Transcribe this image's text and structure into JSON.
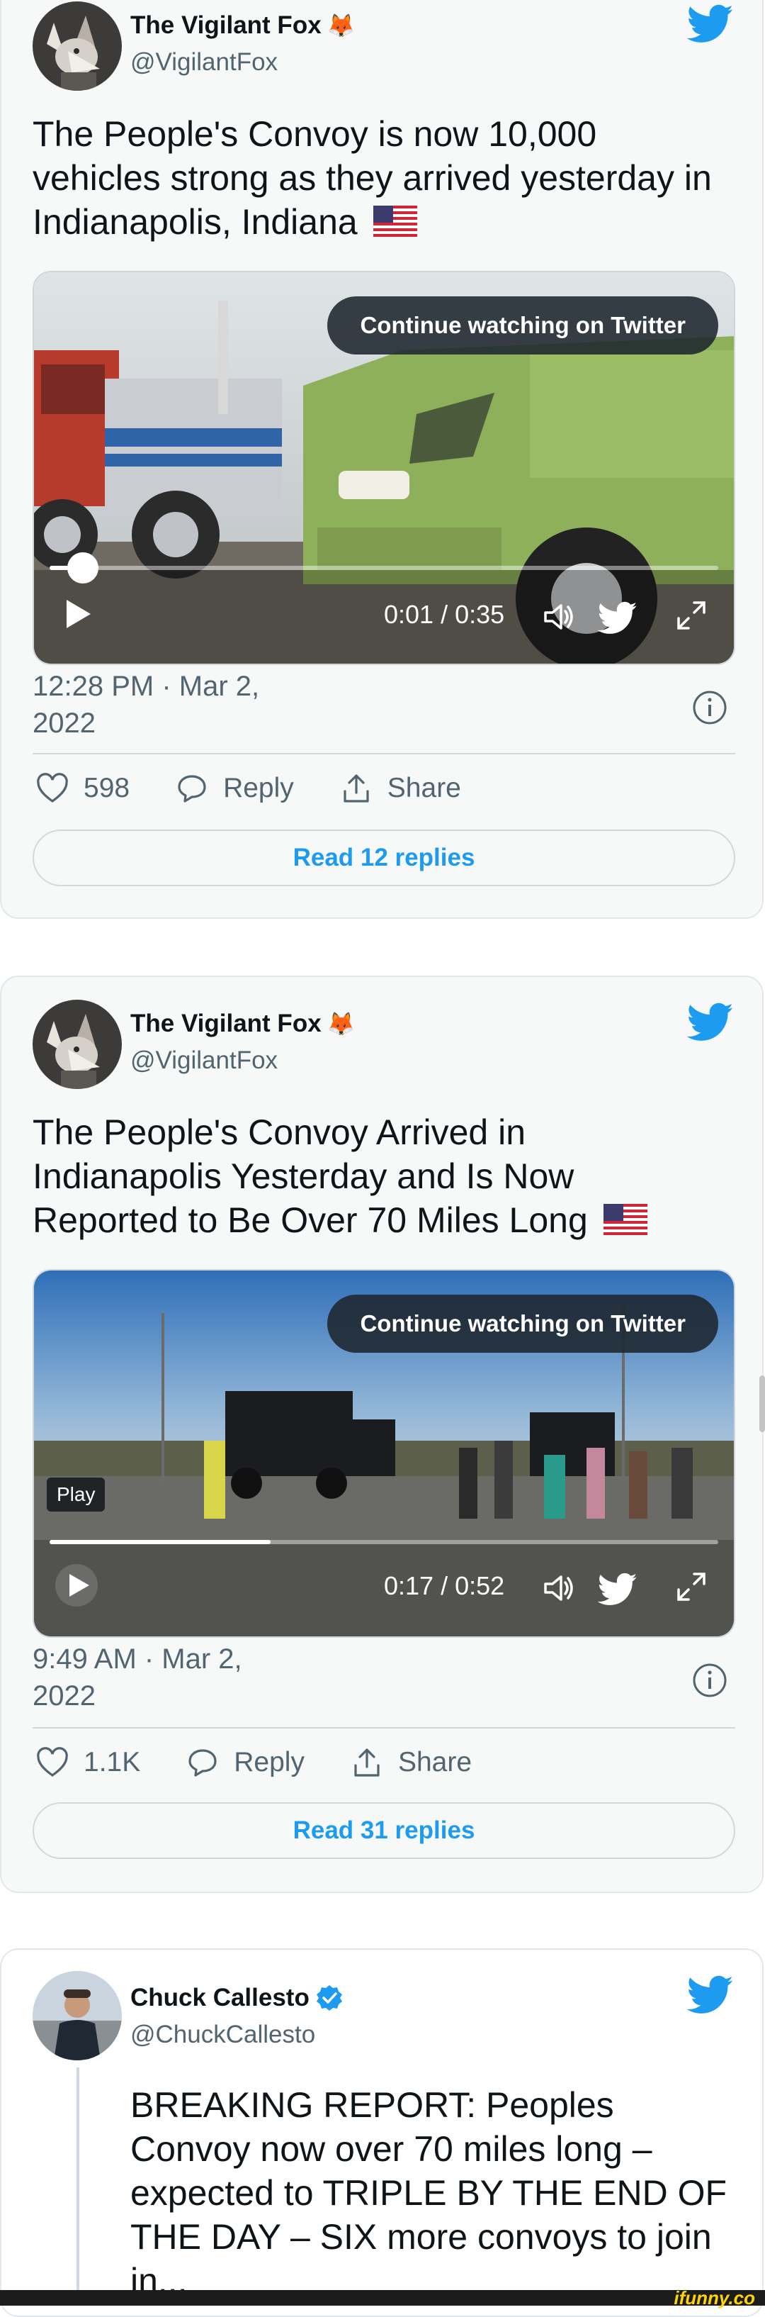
{
  "tweets": [
    {
      "author_name": "The Vigilant Fox",
      "author_emoji": "🦊",
      "handle": "@VigilantFox",
      "text": "The People's Convoy is now 10,000 vehicles strong as they arrived yesterday in Indianapolis, Indiana",
      "video": {
        "overlay_button": "Continue watching on Twitter",
        "time": "0:01 / 0:35",
        "progress": 0.05
      },
      "timestamp_line1": "12:28 PM · Mar 2,",
      "timestamp_line2": "2022",
      "likes": "598",
      "reply_label": "Reply",
      "share_label": "Share",
      "read_replies": "Read 12 replies"
    },
    {
      "author_name": "The Vigilant Fox",
      "author_emoji": "🦊",
      "handle": "@VigilantFox",
      "text": "The People's Convoy Arrived in Indianapolis Yesterday and Is Now Reported to Be Over 70 Miles Long",
      "video": {
        "overlay_button": "Continue watching on Twitter",
        "play_tooltip": "Play",
        "time": "0:17 / 0:52",
        "progress": 0.33
      },
      "timestamp_line1": "9:49 AM · Mar 2,",
      "timestamp_line2": "2022",
      "likes": "1.1K",
      "reply_label": "Reply",
      "share_label": "Share",
      "read_replies": "Read 31 replies"
    },
    {
      "author_name": "Chuck Callesto",
      "handle": "@ChuckCallesto",
      "verified": true,
      "text": "BREAKING REPORT: Peoples Convoy now over 70 miles long – expected to TRIPLE BY THE END OF THE DAY – SIX more convoys to join in..."
    }
  ],
  "watermark": "ifunny.co",
  "colors": {
    "twitter_blue": "#1d9bf0",
    "text": "#0f1419",
    "secondary": "#536471",
    "card_bg": "#f7f9f9",
    "border": "#e1e8ed"
  },
  "icons": [
    "twitter-bird-icon",
    "play-icon",
    "volume-icon",
    "fullscreen-icon",
    "heart-icon",
    "reply-icon",
    "share-icon",
    "info-icon",
    "verified-icon",
    "us-flag-icon",
    "fox-icon"
  ]
}
